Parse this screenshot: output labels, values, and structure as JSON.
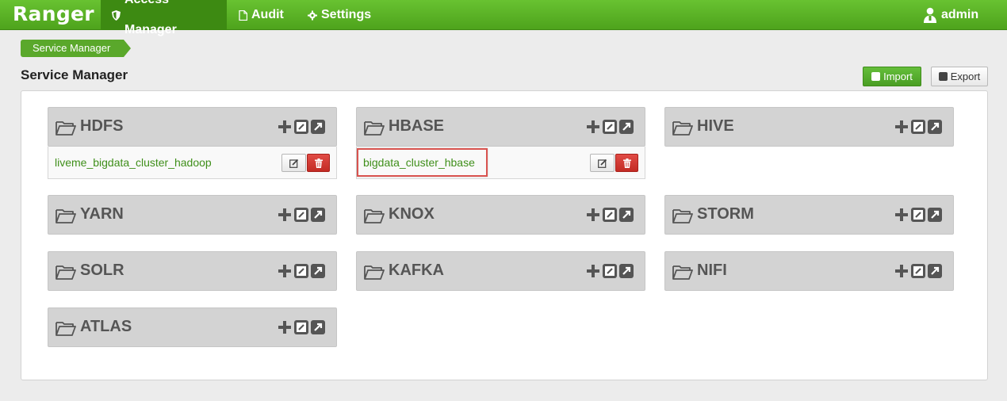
{
  "nav": {
    "brand": "Ranger",
    "items": [
      {
        "label": "Access Manager",
        "icon": "shield-icon"
      },
      {
        "label": "Audit",
        "icon": "file-icon"
      },
      {
        "label": "Settings",
        "icon": "gear-icon"
      }
    ],
    "user": "admin"
  },
  "breadcrumb": "Service Manager",
  "page_title": "Service Manager",
  "buttons": {
    "import": "Import",
    "export": "Export"
  },
  "services": [
    {
      "name": "HDFS",
      "instances": [
        "liveme_bigdata_cluster_hadoop"
      ]
    },
    {
      "name": "HBASE",
      "instances": [
        "bigdata_cluster_hbase"
      ]
    },
    {
      "name": "HIVE",
      "instances": []
    },
    {
      "name": "YARN",
      "instances": []
    },
    {
      "name": "KNOX",
      "instances": []
    },
    {
      "name": "STORM",
      "instances": []
    },
    {
      "name": "SOLR",
      "instances": []
    },
    {
      "name": "KAFKA",
      "instances": []
    },
    {
      "name": "NIFI",
      "instances": []
    },
    {
      "name": "ATLAS",
      "instances": []
    }
  ],
  "colors": {
    "brand_green": "#5aa82b",
    "danger_red": "#c9302c",
    "link_green": "#3f8f1a"
  }
}
